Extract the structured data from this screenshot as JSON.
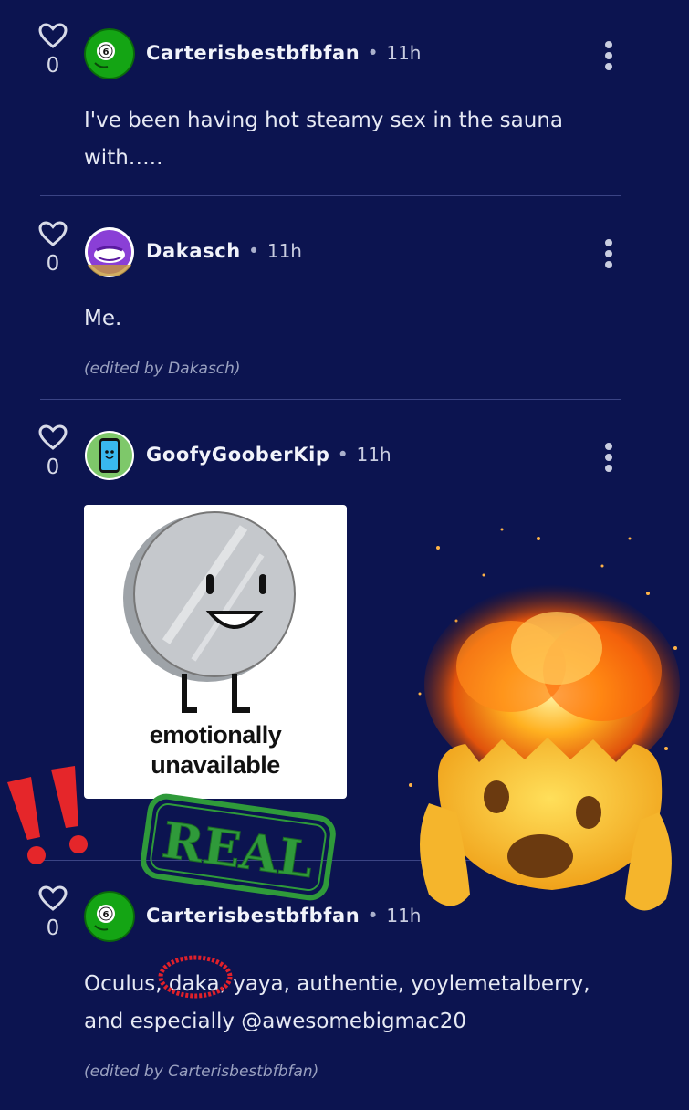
{
  "comments": [
    {
      "votes": "0",
      "username": "Carterisbestbfbfan",
      "separator": "•",
      "time": "11h",
      "avatar_badge": "6",
      "text_lines": [
        "I've been having hot steamy sex in the sauna",
        "with….."
      ]
    },
    {
      "votes": "0",
      "username": "Dakasch",
      "separator": "•",
      "time": "11h",
      "text_lines": [
        "Me."
      ],
      "edited": "(edited by Dakasch)"
    },
    {
      "votes": "0",
      "username": "GoofyGooberKip",
      "separator": "•",
      "time": "11h",
      "image_caption": [
        "emotionally",
        "unavailable"
      ]
    },
    {
      "votes": "0",
      "username": "Carterisbestbfbfan",
      "separator": "•",
      "time": "11h",
      "avatar_badge": "6",
      "text_lines": [
        "Oculus, daka, yaya, authentie, yoylemetalberry,",
        "and especially @awesomebigmac20"
      ],
      "edited": "(edited by Carterisbestbfbfan)"
    }
  ],
  "stickers": {
    "real_stamp": "REAL",
    "exclamation": "!!",
    "exploding_head": "exploding-head-icon"
  },
  "colors": {
    "background": "#0c1450",
    "divider": "#3b4485",
    "avatar_green": "#14a514",
    "circle_red": "#e0202a",
    "stamp_green": "#2f9a3a"
  }
}
